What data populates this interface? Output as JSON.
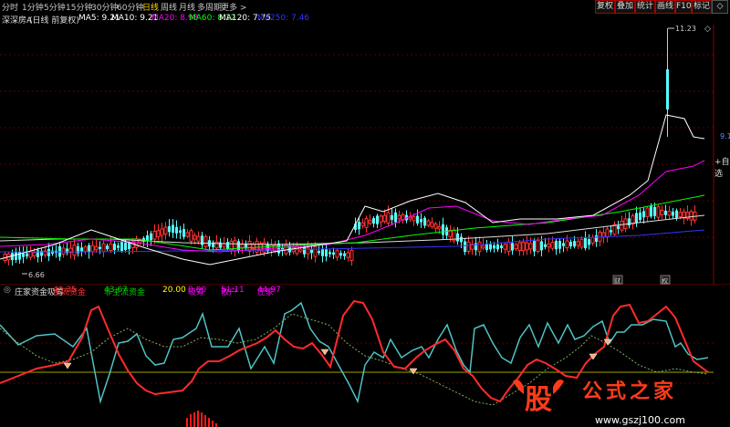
{
  "toolbar": {
    "timeframes": [
      "分时",
      "1分钟",
      "5分钟",
      "15分钟",
      "30分钟",
      "60分钟",
      "日线",
      "周线",
      "月线",
      "多周期",
      "更多 >"
    ],
    "active_timeframe": "日线",
    "right_buttons": [
      "复权",
      "叠加",
      "统计",
      "画线",
      "F10",
      "标记",
      "◇"
    ]
  },
  "stock": {
    "name": "深深房A",
    "mode": "(日线 前复权)"
  },
  "ma": [
    {
      "label": "MA5: 9.21",
      "color": "#ffffff"
    },
    {
      "label": "MA10: 9.21",
      "color": "#ffffff"
    },
    {
      "label": "MA20: 8.98",
      "color": "#ff00ff"
    },
    {
      "label": "MA60: 8.12",
      "color": "#00ff00"
    },
    {
      "label": "MA120: 7.75",
      "color": "#ffffff"
    },
    {
      "label": "MA250: 7.46",
      "color": "#3333ff"
    }
  ],
  "price_labels": {
    "high": "11.23",
    "low": "6.66",
    "current": "9.1"
  },
  "right_panel": {
    "add_self": "+自选"
  },
  "markers": {
    "cai": "财",
    "quan": "权"
  },
  "indicator": {
    "name": "庄家资金吸筹",
    "items": [
      {
        "label": "主流资金",
        "value": "49.35",
        "color": "#ff3333"
      },
      {
        "label": "非主流资金",
        "value": "43.67",
        "color": "#00cc00"
      },
      {
        "label": "",
        "value": "20.00",
        "color": "#ffff00"
      },
      {
        "label": "吸筹",
        "value": "0.00",
        "color": "#ff00ff"
      },
      {
        "label": "散户",
        "value": "51.11",
        "color": "#ff00ff"
      },
      {
        "label": "庄家",
        "value": "44.97",
        "color": "#ff00ff"
      }
    ]
  },
  "watermark": {
    "glyph": "股",
    "text": "公式之家",
    "url": "www.gszj100.com"
  },
  "colors": {
    "up": "#ff3232",
    "down": "#54ffff",
    "ma5": "#ffffff",
    "ma20": "#ff00ff",
    "ma60": "#00ff00",
    "ma250": "#3333ff",
    "grid": "#8b0000"
  }
}
